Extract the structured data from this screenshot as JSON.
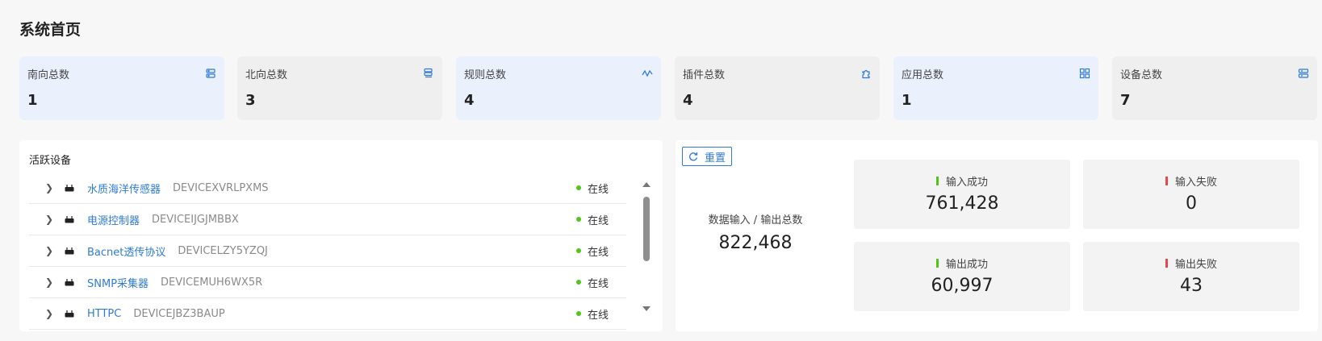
{
  "page": {
    "title": "系统首页"
  },
  "summary": [
    {
      "label": "南向总数",
      "value": "1",
      "icon": "south-devices-icon"
    },
    {
      "label": "北向总数",
      "value": "3",
      "icon": "north-apps-icon"
    },
    {
      "label": "规则总数",
      "value": "4",
      "icon": "rules-icon"
    },
    {
      "label": "插件总数",
      "value": "4",
      "icon": "plugin-icon"
    },
    {
      "label": "应用总数",
      "value": "1",
      "icon": "apps-grid-icon"
    },
    {
      "label": "设备总数",
      "value": "7",
      "icon": "devices-icon"
    }
  ],
  "active_devices": {
    "title": "活跃设备",
    "rows": [
      {
        "name": "水质海洋传感器",
        "id": "DEVICEXVRLPXMS",
        "status": "在线"
      },
      {
        "name": "电源控制器",
        "id": "DEVICEIJGJMBBX",
        "status": "在线"
      },
      {
        "name": "Bacnet透传协议",
        "id": "DEVICELZY5YZQJ",
        "status": "在线"
      },
      {
        "name": "SNMP采集器",
        "id": "DEVICEMUH6WX5R",
        "status": "在线"
      },
      {
        "name": "HTTPC",
        "id": "DEVICEJBZ3BAUP",
        "status": "在线"
      }
    ]
  },
  "stats": {
    "reset_label": "重置",
    "total_label": "数据输入 / 输出总数",
    "total_value": "822,468",
    "input_success_label": "输入成功",
    "input_success_value": "761,428",
    "input_fail_label": "输入失败",
    "input_fail_value": "0",
    "output_success_label": "输出成功",
    "output_success_value": "60,997",
    "output_fail_label": "输出失败",
    "output_fail_value": "43"
  },
  "colors": {
    "accent": "#2f7bd6",
    "success": "#52c41a",
    "failure": "#e5484d"
  }
}
